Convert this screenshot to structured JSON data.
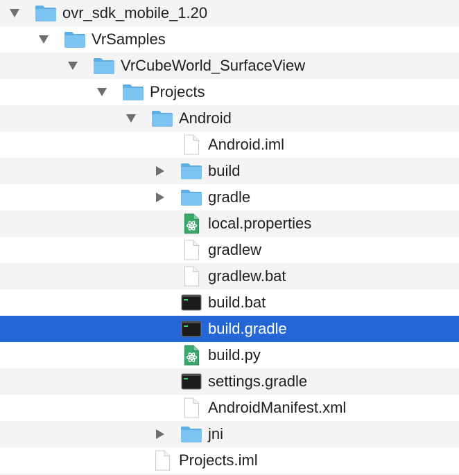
{
  "rows": [
    {
      "label": "ovr_sdk_mobile_1.20",
      "kind": "folder",
      "expanded": true,
      "depth": 0
    },
    {
      "label": "VrSamples",
      "kind": "folder",
      "expanded": true,
      "depth": 1
    },
    {
      "label": "VrCubeWorld_SurfaceView",
      "kind": "folder",
      "expanded": true,
      "depth": 2
    },
    {
      "label": "Projects",
      "kind": "folder",
      "expanded": true,
      "depth": 3
    },
    {
      "label": "Android",
      "kind": "folder",
      "expanded": true,
      "depth": 4
    },
    {
      "label": "Android.iml",
      "kind": "doc",
      "depth": 5
    },
    {
      "label": "build",
      "kind": "folder",
      "expanded": false,
      "depth": 5
    },
    {
      "label": "gradle",
      "kind": "folder",
      "expanded": false,
      "depth": 5
    },
    {
      "label": "local.properties",
      "kind": "atom",
      "depth": 5
    },
    {
      "label": "gradlew",
      "kind": "doc",
      "depth": 5
    },
    {
      "label": "gradlew.bat",
      "kind": "doc",
      "depth": 5
    },
    {
      "label": "build.bat",
      "kind": "exec",
      "depth": 5
    },
    {
      "label": "build.gradle",
      "kind": "exec",
      "depth": 5,
      "selected": true
    },
    {
      "label": "build.py",
      "kind": "atom",
      "depth": 5
    },
    {
      "label": "settings.gradle",
      "kind": "exec",
      "depth": 5
    },
    {
      "label": "AndroidManifest.xml",
      "kind": "doc",
      "depth": 5
    },
    {
      "label": "jni",
      "kind": "folder",
      "expanded": false,
      "depth": 5
    },
    {
      "label": "Projects.iml",
      "kind": "doc",
      "depth": 4
    }
  ],
  "colors": {
    "selection": "#2466d6",
    "folder": "#7cc3f1",
    "folder_dark": "#5eaee6",
    "atom_green": "#3aa76d",
    "exec_black": "#1c1c1c",
    "stripe": "#f4f4f4",
    "triangle": "#6e6e6e"
  },
  "icon_names": {
    "folder": "folder-icon",
    "doc": "document-icon",
    "atom": "atom-document-icon",
    "exec": "terminal-executable-icon"
  }
}
